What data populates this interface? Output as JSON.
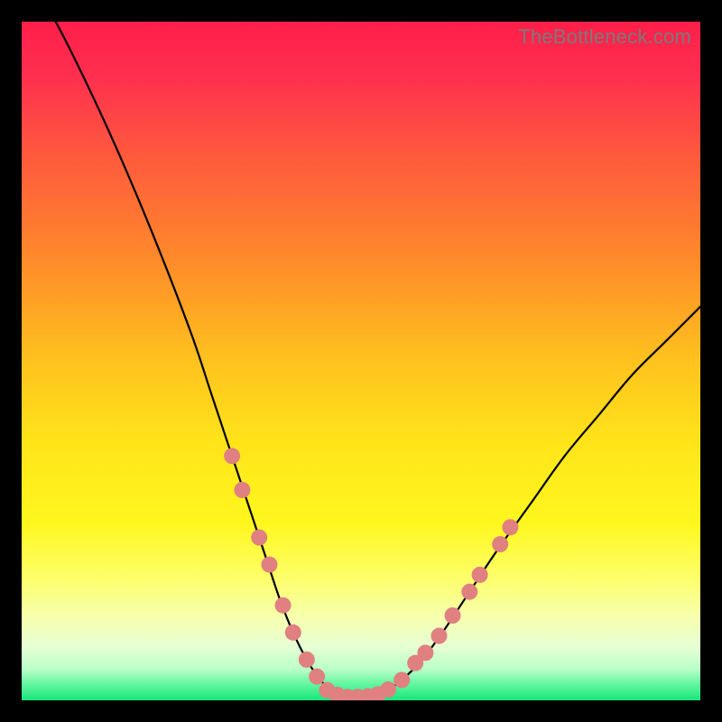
{
  "watermark": "TheBottleneck.com",
  "gradient": {
    "stops": [
      {
        "offset": 0.0,
        "color": "#ff1f4a"
      },
      {
        "offset": 0.08,
        "color": "#ff2f4f"
      },
      {
        "offset": 0.2,
        "color": "#ff5a3d"
      },
      {
        "offset": 0.35,
        "color": "#ff8a2a"
      },
      {
        "offset": 0.5,
        "color": "#ffc21e"
      },
      {
        "offset": 0.62,
        "color": "#ffe41a"
      },
      {
        "offset": 0.74,
        "color": "#fff71e"
      },
      {
        "offset": 0.82,
        "color": "#fdff6a"
      },
      {
        "offset": 0.88,
        "color": "#f6ffb0"
      },
      {
        "offset": 0.92,
        "color": "#e8ffd4"
      },
      {
        "offset": 0.955,
        "color": "#b8ffc8"
      },
      {
        "offset": 0.975,
        "color": "#66f7a0"
      },
      {
        "offset": 1.0,
        "color": "#18e57a"
      }
    ]
  },
  "chart_data": {
    "type": "line",
    "title": "",
    "xlabel": "",
    "ylabel": "",
    "xlim": [
      0,
      100
    ],
    "ylim": [
      0,
      100
    ],
    "series": [
      {
        "name": "bottleneck-curve",
        "x": [
          0,
          5,
          10,
          15,
          20,
          25,
          28,
          31,
          34,
          36,
          38,
          40,
          42,
          44,
          46,
          48,
          50,
          53,
          56,
          59,
          62,
          66,
          70,
          75,
          80,
          85,
          90,
          95,
          100
        ],
        "values": [
          108,
          100,
          90,
          79,
          67,
          54,
          45,
          36,
          27,
          21,
          15,
          10,
          6,
          3,
          1.2,
          0.5,
          0.5,
          1.0,
          3,
          6,
          10,
          16,
          22,
          29,
          36,
          42,
          48,
          53,
          58
        ]
      }
    ],
    "markers": {
      "name": "highlight-dots",
      "color": "#e08080",
      "radius": 9,
      "points": [
        {
          "x": 31.0,
          "y": 36
        },
        {
          "x": 32.5,
          "y": 31
        },
        {
          "x": 35.0,
          "y": 24
        },
        {
          "x": 36.5,
          "y": 20
        },
        {
          "x": 38.5,
          "y": 14
        },
        {
          "x": 40.0,
          "y": 10
        },
        {
          "x": 42.0,
          "y": 6
        },
        {
          "x": 43.5,
          "y": 3.5
        },
        {
          "x": 45.0,
          "y": 1.5
        },
        {
          "x": 46.5,
          "y": 0.8
        },
        {
          "x": 48.0,
          "y": 0.5
        },
        {
          "x": 49.5,
          "y": 0.5
        },
        {
          "x": 51.0,
          "y": 0.6
        },
        {
          "x": 52.5,
          "y": 0.9
        },
        {
          "x": 54.0,
          "y": 1.6
        },
        {
          "x": 56.0,
          "y": 3
        },
        {
          "x": 58.0,
          "y": 5.5
        },
        {
          "x": 59.5,
          "y": 7
        },
        {
          "x": 61.5,
          "y": 9.5
        },
        {
          "x": 63.5,
          "y": 12.5
        },
        {
          "x": 66.0,
          "y": 16
        },
        {
          "x": 67.5,
          "y": 18.5
        },
        {
          "x": 70.5,
          "y": 23
        },
        {
          "x": 72.0,
          "y": 25.5
        }
      ]
    }
  }
}
